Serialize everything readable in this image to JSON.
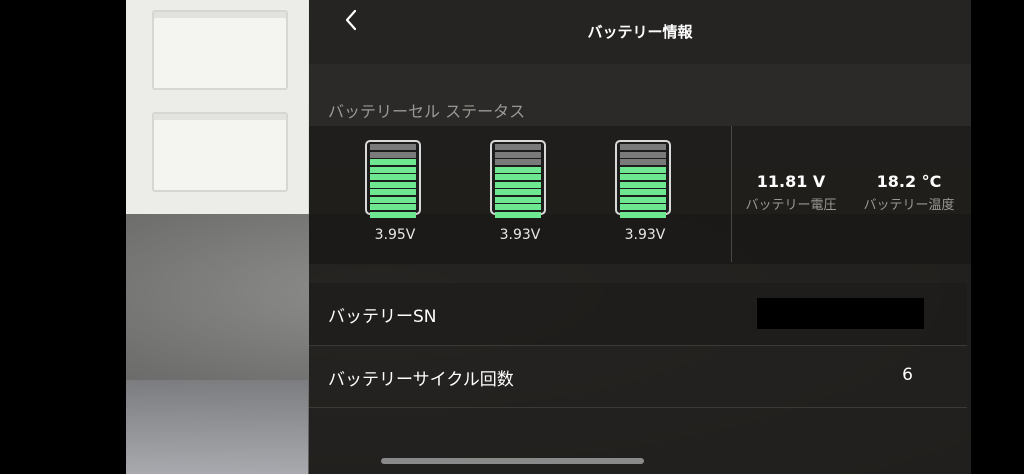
{
  "header": {
    "title": "バッテリー情報"
  },
  "cell_status": {
    "label": "バッテリーセル ステータス",
    "cells": [
      {
        "voltage": "3.95V",
        "charge_bars": 8,
        "total_bars": 10
      },
      {
        "voltage": "3.93V",
        "charge_bars": 7,
        "total_bars": 10
      },
      {
        "voltage": "3.93V",
        "charge_bars": 7,
        "total_bars": 10
      }
    ]
  },
  "stats": {
    "voltage": {
      "value": "11.81 V",
      "label": "バッテリー電圧"
    },
    "temperature": {
      "value": "18.2 °C",
      "label": "バッテリー温度"
    }
  },
  "rows": {
    "sn": {
      "label": "バッテリーSN"
    },
    "cycles": {
      "label": "バッテリーサイクル回数",
      "value": "6"
    }
  },
  "colors": {
    "cell_fill": "#6de890",
    "cell_empty": "#7a7a7a",
    "panel_bg": "#1e1c1a"
  },
  "icons": {
    "back": "chevron-left-icon"
  }
}
